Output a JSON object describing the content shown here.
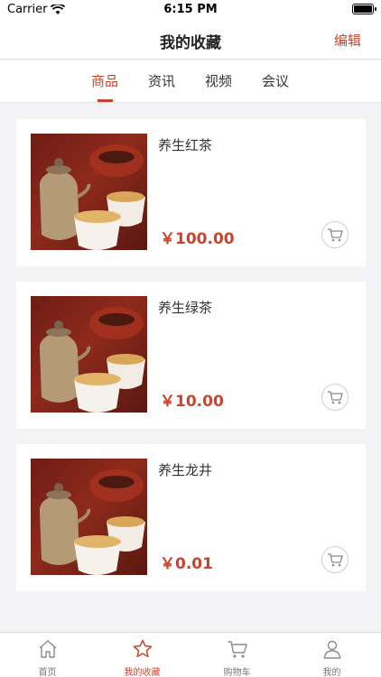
{
  "status_bar": {
    "carrier": "Carrier",
    "time": "6:15 PM"
  },
  "nav": {
    "title": "我的收藏",
    "edit_label": "编辑"
  },
  "tabs": [
    {
      "label": "商品",
      "active": true
    },
    {
      "label": "资讯",
      "active": false
    },
    {
      "label": "视频",
      "active": false
    },
    {
      "label": "会议",
      "active": false
    }
  ],
  "products": [
    {
      "name": "养生红茶",
      "price": "￥100.00",
      "image_icon": "tea-set-image"
    },
    {
      "name": "养生绿茶",
      "price": "￥10.00",
      "image_icon": "tea-set-image"
    },
    {
      "name": "养生龙井",
      "price": "￥0.01",
      "image_icon": "tea-set-image"
    }
  ],
  "tab_bar": [
    {
      "label": "首页",
      "icon": "home-icon",
      "active": false
    },
    {
      "label": "我的收藏",
      "icon": "star-icon",
      "active": true
    },
    {
      "label": "购物车",
      "icon": "cart-icon",
      "active": false
    },
    {
      "label": "我的",
      "icon": "user-icon",
      "active": false
    }
  ],
  "colors": {
    "accent": "#c9442e",
    "background": "#f3f3f6"
  }
}
